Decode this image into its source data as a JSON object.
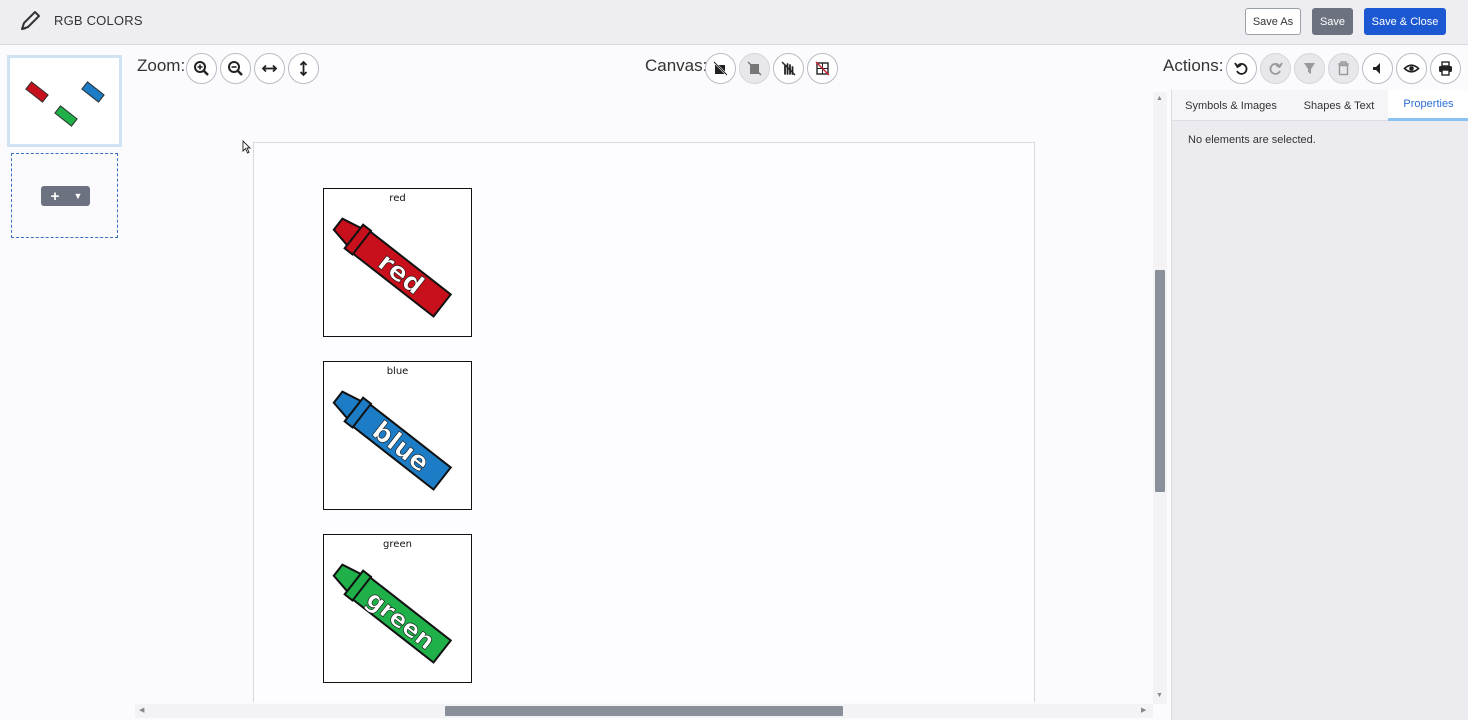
{
  "header": {
    "title": "RGB COLORS",
    "save_as_label": "Save As",
    "save_label": "Save",
    "save_close_label": "Save & Close"
  },
  "toolbar": {
    "zoom_label": "Zoom:",
    "canvas_label": "Canvas:",
    "actions_label": "Actions:"
  },
  "canvas": {
    "cards": [
      {
        "label": "red",
        "crayon_text": "red",
        "color": "#c8101c",
        "dark": "#7a0a10"
      },
      {
        "label": "blue",
        "crayon_text": "blue",
        "color": "#1d7cc6",
        "dark": "#0f4a78"
      },
      {
        "label": "green",
        "crayon_text": "green",
        "color": "#1fb04a",
        "dark": "#0e6a2a"
      }
    ]
  },
  "right_panel": {
    "tabs": [
      "Symbols & Images",
      "Shapes & Text",
      "Properties"
    ],
    "active_tab": "Properties",
    "empty_message": "No elements are selected."
  },
  "icons": {
    "zoom": [
      "zoom-in-icon",
      "zoom-out-icon",
      "fit-width-icon",
      "fit-height-icon"
    ],
    "canvas": [
      "canvas-select-icon",
      "canvas-background-icon",
      "canvas-hand-icon",
      "canvas-grid-icon"
    ],
    "actions": [
      "undo-icon",
      "redo-icon",
      "format-painter-icon",
      "delete-icon",
      "speak-icon",
      "preview-icon",
      "print-icon"
    ]
  }
}
